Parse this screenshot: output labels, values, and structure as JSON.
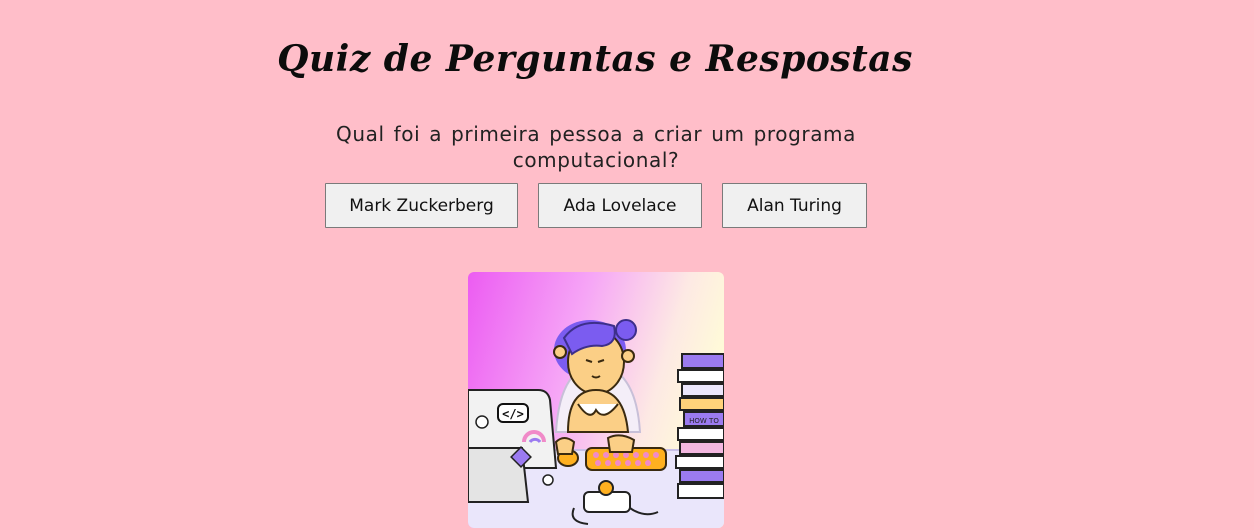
{
  "header": {
    "title": "Quiz de Perguntas e Respostas"
  },
  "quiz": {
    "question": "Qual foi a primeira pessoa a criar um programa computacional?",
    "answers": [
      {
        "label": "Mark Zuckerberg"
      },
      {
        "label": "Ada Lovelace"
      },
      {
        "label": "Alan Turing"
      }
    ]
  },
  "illustration": {
    "icon": "girl-programming-illustration",
    "sticker_text": "</>",
    "book_text": "HOW TO"
  },
  "colors": {
    "background": "#ffbec9",
    "button_bg": "#f0f0f0",
    "hair": "#7b5cf0",
    "keyboard": "#ffb020"
  }
}
